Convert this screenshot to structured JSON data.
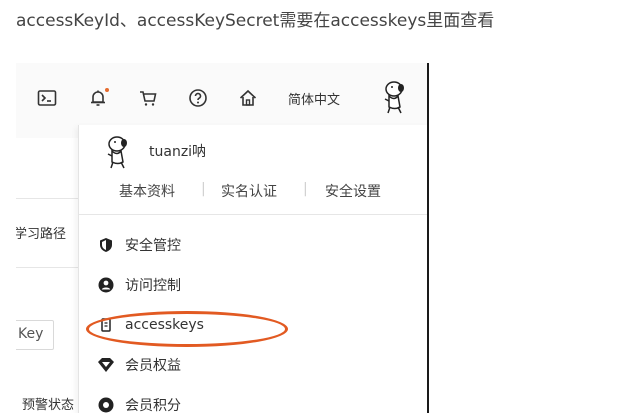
{
  "caption": "accessKeyId、accessKeySecret需要在accesskeys里面查看",
  "topbar": {
    "icons": [
      "terminal-icon",
      "bell-icon",
      "cart-icon",
      "help-icon",
      "home-icon"
    ],
    "language": "简体中文"
  },
  "left": {
    "learning_path": "学习路径",
    "key_field": "Key",
    "alarm_status": "预警状态"
  },
  "dropdown": {
    "username": "tuanzi呐",
    "profile_links": [
      "基本资料",
      "实名认证",
      "安全设置"
    ],
    "divider": "|",
    "menu": [
      {
        "label": "安全管控",
        "icon": "shield-icon"
      },
      {
        "label": "访问控制",
        "icon": "user-icon"
      },
      {
        "label": "accesskeys",
        "icon": "key-icon"
      },
      {
        "label": "会员权益",
        "icon": "diamond-icon"
      },
      {
        "label": "会员积分",
        "icon": "points-icon"
      }
    ]
  },
  "colors": {
    "highlight": "#e25a22",
    "notification_dot": "#e66b2e"
  }
}
